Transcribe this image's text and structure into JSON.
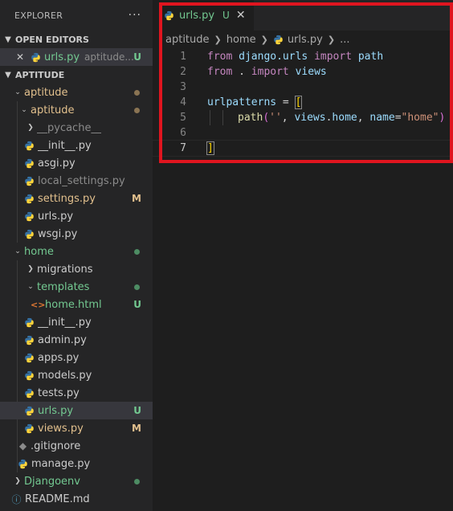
{
  "explorer": {
    "title": "EXPLORER",
    "more_label": "···"
  },
  "open_editors": {
    "header": "OPEN EDITORS",
    "item": {
      "close_glyph": "✕",
      "name": "urls.py",
      "description": "aptitude...",
      "decoration": "U"
    }
  },
  "workspace": {
    "header": "APTITUDE",
    "items": [
      {
        "name": "aptitude",
        "kind": "folder-open",
        "state": "modified-dot"
      },
      {
        "name": "aptitude",
        "kind": "folder-open",
        "state": "modified-dot"
      },
      {
        "name": "__pycache__",
        "kind": "folder-closed",
        "state": "dim"
      },
      {
        "name": "__init__.py",
        "kind": "py"
      },
      {
        "name": "asgi.py",
        "kind": "py"
      },
      {
        "name": "local_settings.py",
        "kind": "py",
        "state": "dim"
      },
      {
        "name": "settings.py",
        "kind": "py",
        "decoration": "M"
      },
      {
        "name": "urls.py",
        "kind": "py"
      },
      {
        "name": "wsgi.py",
        "kind": "py"
      },
      {
        "name": "home",
        "kind": "folder-open",
        "state": "new-dot"
      },
      {
        "name": "migrations",
        "kind": "folder-closed"
      },
      {
        "name": "templates",
        "kind": "folder-open",
        "state": "new-dot"
      },
      {
        "name": "home.html",
        "kind": "html",
        "decoration": "U"
      },
      {
        "name": "__init__.py",
        "kind": "py"
      },
      {
        "name": "admin.py",
        "kind": "py"
      },
      {
        "name": "apps.py",
        "kind": "py"
      },
      {
        "name": "models.py",
        "kind": "py"
      },
      {
        "name": "tests.py",
        "kind": "py"
      },
      {
        "name": "urls.py",
        "kind": "py",
        "decoration": "U"
      },
      {
        "name": "views.py",
        "kind": "py",
        "decoration": "M"
      },
      {
        "name": ".gitignore",
        "kind": "git"
      },
      {
        "name": "manage.py",
        "kind": "py"
      },
      {
        "name": "Djangoenv",
        "kind": "folder-closed",
        "state": "new-dot"
      },
      {
        "name": "README.md",
        "kind": "md"
      }
    ]
  },
  "editor": {
    "tab": {
      "label": "urls.py",
      "decoration": "U",
      "close_glyph": "✕"
    },
    "breadcrumb": [
      "aptitude",
      "home",
      "urls.py",
      "..."
    ],
    "line_numbers": [
      "1",
      "2",
      "3",
      "4",
      "5",
      "6",
      "7"
    ],
    "code": {
      "l1": {
        "kw1": "from",
        "mod": "django.urls",
        "kw2": "import",
        "name": "path"
      },
      "l2": {
        "kw1": "from",
        "mod": ".",
        "kw2": "import",
        "name": "views"
      },
      "l4": {
        "var": "urlpatterns",
        "eq": " = ",
        "bracket": "["
      },
      "l5": {
        "fn": "path",
        "open": "(",
        "str1": "''",
        "comma1": ", ",
        "obj": "views",
        "dot": ".",
        "attr": "home",
        "comma2": ", ",
        "kwarg": "name",
        "eq": "=",
        "str2": "\"home\"",
        "close": ")"
      },
      "l7": {
        "bracket": "]"
      }
    }
  },
  "colors": {
    "modified": "#e2c08d",
    "untracked": "#73c991",
    "annotation_box": "#e0151f",
    "python_blue": "#3572a5",
    "python_yellow": "#ffd43b"
  }
}
